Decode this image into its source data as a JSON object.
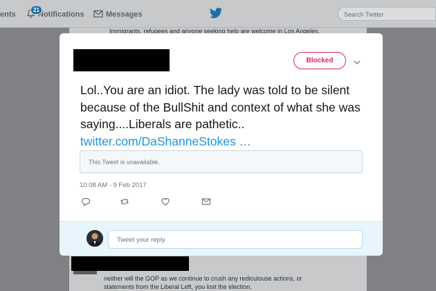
{
  "nav": {
    "home_fragment": "ents",
    "notifications_label": "Notifications",
    "notifications_count": "21",
    "messages_label": "Messages",
    "search_placeholder": "Search Twitter"
  },
  "background": {
    "top_line": "Immigrants, refugees and anyone seeking help are welcome in Los Angeles.",
    "reply_text": "neither will the GOP as we continue to crush any rediculouse actions, or statements from the Liberal Left, you lost the election."
  },
  "tweet": {
    "blocked_label": "Blocked",
    "text": "Lol..You are an idiot.  The lady was told to be silent because of the BullShit and context of what she was saying....Liberals are pathetic..",
    "link": "twitter.com/DaShanneStokes …",
    "quote_unavailable": "This Tweet is unavailable.",
    "timestamp": "10:08 AM - 9 Feb 2017",
    "reply_placeholder": "Tweet your reply"
  },
  "colors": {
    "blocked": "#e0245e",
    "link": "#1b95e0",
    "reply_bg": "#e8f5fd"
  }
}
